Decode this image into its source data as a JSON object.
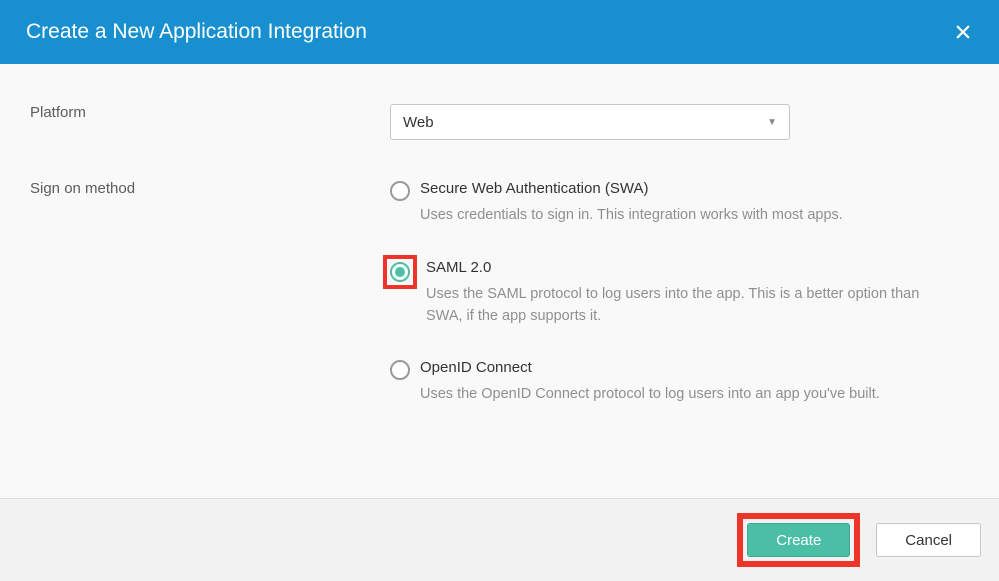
{
  "header": {
    "title": "Create a New Application Integration"
  },
  "form": {
    "platform": {
      "label": "Platform",
      "selected": "Web"
    },
    "signon": {
      "label": "Sign on method",
      "options": [
        {
          "label": "Secure Web Authentication (SWA)",
          "desc": "Uses credentials to sign in. This integration works with most apps.",
          "selected": false,
          "highlighted": false
        },
        {
          "label": "SAML 2.0",
          "desc": "Uses the SAML protocol to log users into the app. This is a better option than SWA, if the app supports it.",
          "selected": true,
          "highlighted": true
        },
        {
          "label": "OpenID Connect",
          "desc": "Uses the OpenID Connect protocol to log users into an app you've built.",
          "selected": false,
          "highlighted": false
        }
      ]
    }
  },
  "footer": {
    "create_label": "Create",
    "cancel_label": "Cancel"
  }
}
